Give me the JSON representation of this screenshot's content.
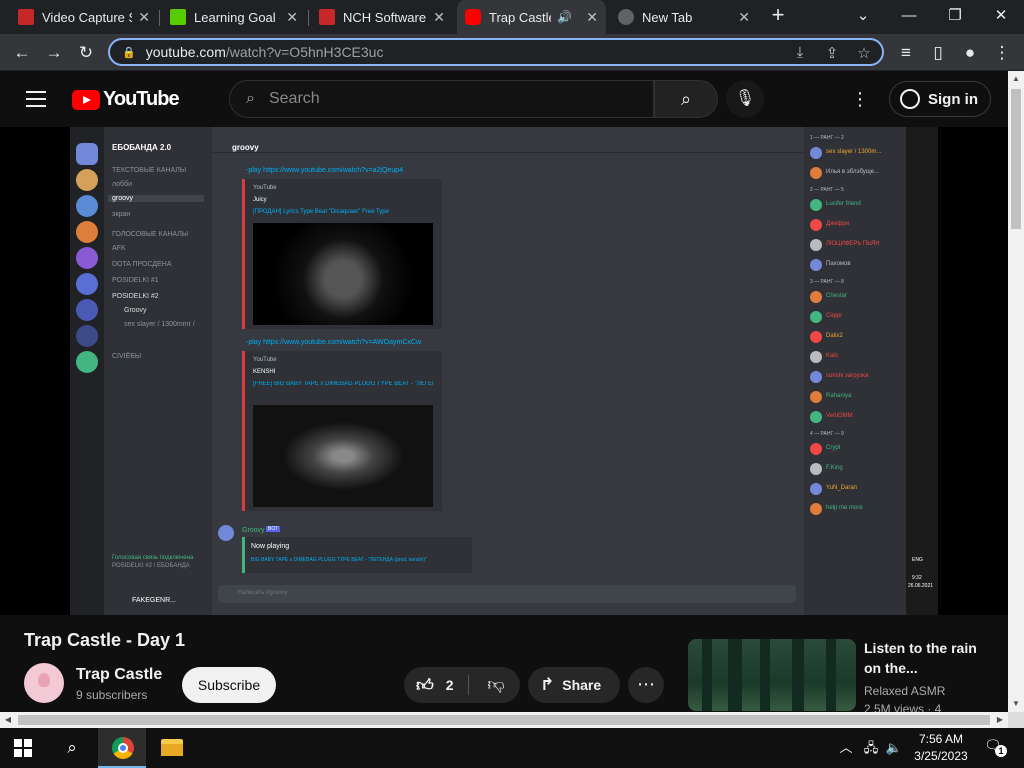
{
  "browser": {
    "tabs": [
      {
        "title": "Video Capture S",
        "favicon_color": "#c62828"
      },
      {
        "title": "Learning Goal -",
        "favicon_color": "#58cc02"
      },
      {
        "title": "NCH Software -",
        "favicon_color": "#c62828"
      },
      {
        "title": "Trap Castle",
        "favicon_color": "#ff0000"
      },
      {
        "title": "New Tab",
        "favicon_color": "#5f6368"
      }
    ],
    "active_tab_index": 3,
    "url": {
      "host": "youtube.com",
      "path": "/watch?v=O5hnH3CE3uc"
    },
    "colors": {
      "tabstrip": "#202124",
      "toolbar": "#35363a",
      "omnibox_focus": "#8ab4f8"
    }
  },
  "youtube": {
    "logo_text": "YouTube",
    "search_placeholder": "Search",
    "signin_label": "Sign in",
    "video": {
      "title": "Trap Castle - Day 1",
      "channel": "Trap Castle",
      "subscribers": "9 subscribers",
      "subscribe_label": "Subscribe",
      "likes": "2",
      "share_label": "Share"
    },
    "recommendation": {
      "title": "Listen to the rain on the...",
      "channel": "Relaxed ASMR",
      "meta": "2.5M views · 4"
    }
  },
  "discord": {
    "server_name": "ЕБОБАНДА 2.0",
    "channel_name": "groovy",
    "channels": [
      "ТЕКСТОВЫЕ КАНАЛЫ",
      "лобби",
      "groovy",
      "экран",
      "ГОЛОСОВЫЕ КАНАЛЫ",
      "AFK",
      "DOTA ПРОСДЕНА",
      "POSIDELKI #1",
      "POSIDELKI #2",
      "Groovy",
      "sex slayer / 1300mmr /",
      "CIVIЁБЫ"
    ],
    "messages": [
      {
        "cmd": "-play https://www.youtube.com/watch?v=a2jQeup4",
        "source": "YouTube",
        "author": "Juicy",
        "title": "[ПРОДАН] Lyrics Type Beat \"Dicaquaer\" Free Type"
      },
      {
        "cmd": "-play https://www.youtube.com/watch?v=AWOaymCxCw",
        "source": "YouTube",
        "author": "KENSHI",
        "title": "[FREE] BIG BABY TAPE x DIMEBAG PLUGG TYPE BEAT - \"ЛЕГЕНДА (prod. ken..."
      }
    ],
    "bot": {
      "name": "Groovy",
      "tag": "BOT",
      "now_playing": "Now playing",
      "track": "BIG BABY TAPE x DIMEBAG PLUGG TYPE BEAT - \"ЛЕГЕНДА (prod. kenshi)\""
    },
    "message_placeholder": "Написать #groovy",
    "user": {
      "name": "FAKEGENR...",
      "status": "Голосовая связь подключена",
      "voice": "POSIDELKI #2 / ЕБОБАНДА"
    },
    "members": [
      {
        "section": "1 — РАНГ — 2",
        "name": "sex slayer / 1300m...",
        "color": "#f0a732"
      },
      {
        "name": "Илья в эблэбуще...",
        "color": "#b9bbbe"
      },
      {
        "section": "2 — РАНГ — 5",
        "name": "Lucifer friend",
        "color": "#43b581"
      },
      {
        "name": "Джефри",
        "color": "#f04747"
      },
      {
        "name": "ЛЮЦИФЕРЬ ПЬЯН",
        "color": "#f04747"
      },
      {
        "name": "Пахомов",
        "color": "#b9bbbe"
      },
      {
        "section": "3 — РАНГ — 8",
        "name": "Chestar",
        "color": "#43b581"
      },
      {
        "name": "Ciqqe",
        "color": "#f04747"
      },
      {
        "name": "Dalix2",
        "color": "#f0a732"
      },
      {
        "name": "Kalo",
        "color": "#f04747"
      },
      {
        "name": "sunshi загрузка",
        "color": "#f04747"
      },
      {
        "name": "Rahaniya",
        "color": "#43b581"
      },
      {
        "name": "VertiGMM",
        "color": "#f04747"
      },
      {
        "section": "4 — РАНГ — 9",
        "name": "Crypt",
        "color": "#43b581"
      },
      {
        "name": "F.King",
        "color": "#43b581"
      },
      {
        "name": "YuN_Daran",
        "color": "#f0a732"
      },
      {
        "name": "help me more",
        "color": "#43b581"
      }
    ],
    "overlay": {
      "lang": "ENG",
      "time": "9:32",
      "date": "26.06.2021"
    }
  },
  "taskbar": {
    "time": "7:56 AM",
    "date": "3/25/2023",
    "notification_count": "1",
    "apps": [
      "chrome",
      "file-explorer"
    ]
  }
}
